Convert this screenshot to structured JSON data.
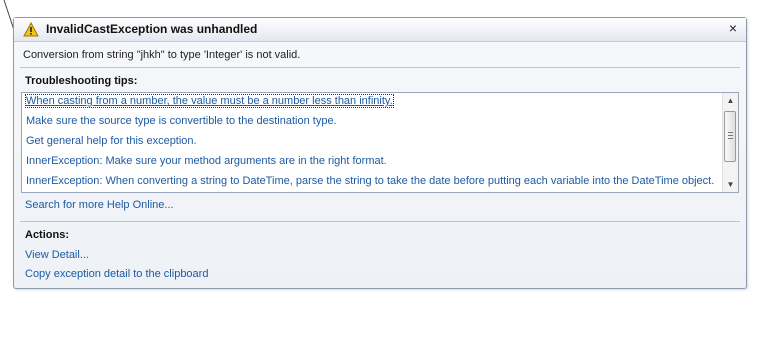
{
  "dialog": {
    "title": "InvalidCastException was unhandled",
    "close_glyph": "×",
    "message": "Conversion from string \"jhkh\" to type 'Integer' is not valid."
  },
  "troubleshooting": {
    "heading": "Troubleshooting tips:",
    "tips": [
      "When casting from a number, the value must be a number less than infinity.",
      "Make sure the source type is convertible to the destination type.",
      "Get general help for this exception.",
      "InnerException: Make sure your method arguments are in the right format.",
      "InnerException: When converting a string to DateTime, parse the string to take the date before putting each variable into the DateTime object."
    ],
    "search_link": "Search for more Help Online..."
  },
  "actions": {
    "heading": "Actions:",
    "items": [
      "View Detail...",
      "Copy exception detail to the clipboard"
    ]
  },
  "icons": {
    "title_icon": "warning-icon",
    "close_icon": "close-icon",
    "scroll_up": "scroll-up-arrow-icon",
    "scroll_down": "scroll-down-arrow-icon"
  },
  "colors": {
    "link": "#1d5aa3",
    "warning": "#f2c31c"
  }
}
